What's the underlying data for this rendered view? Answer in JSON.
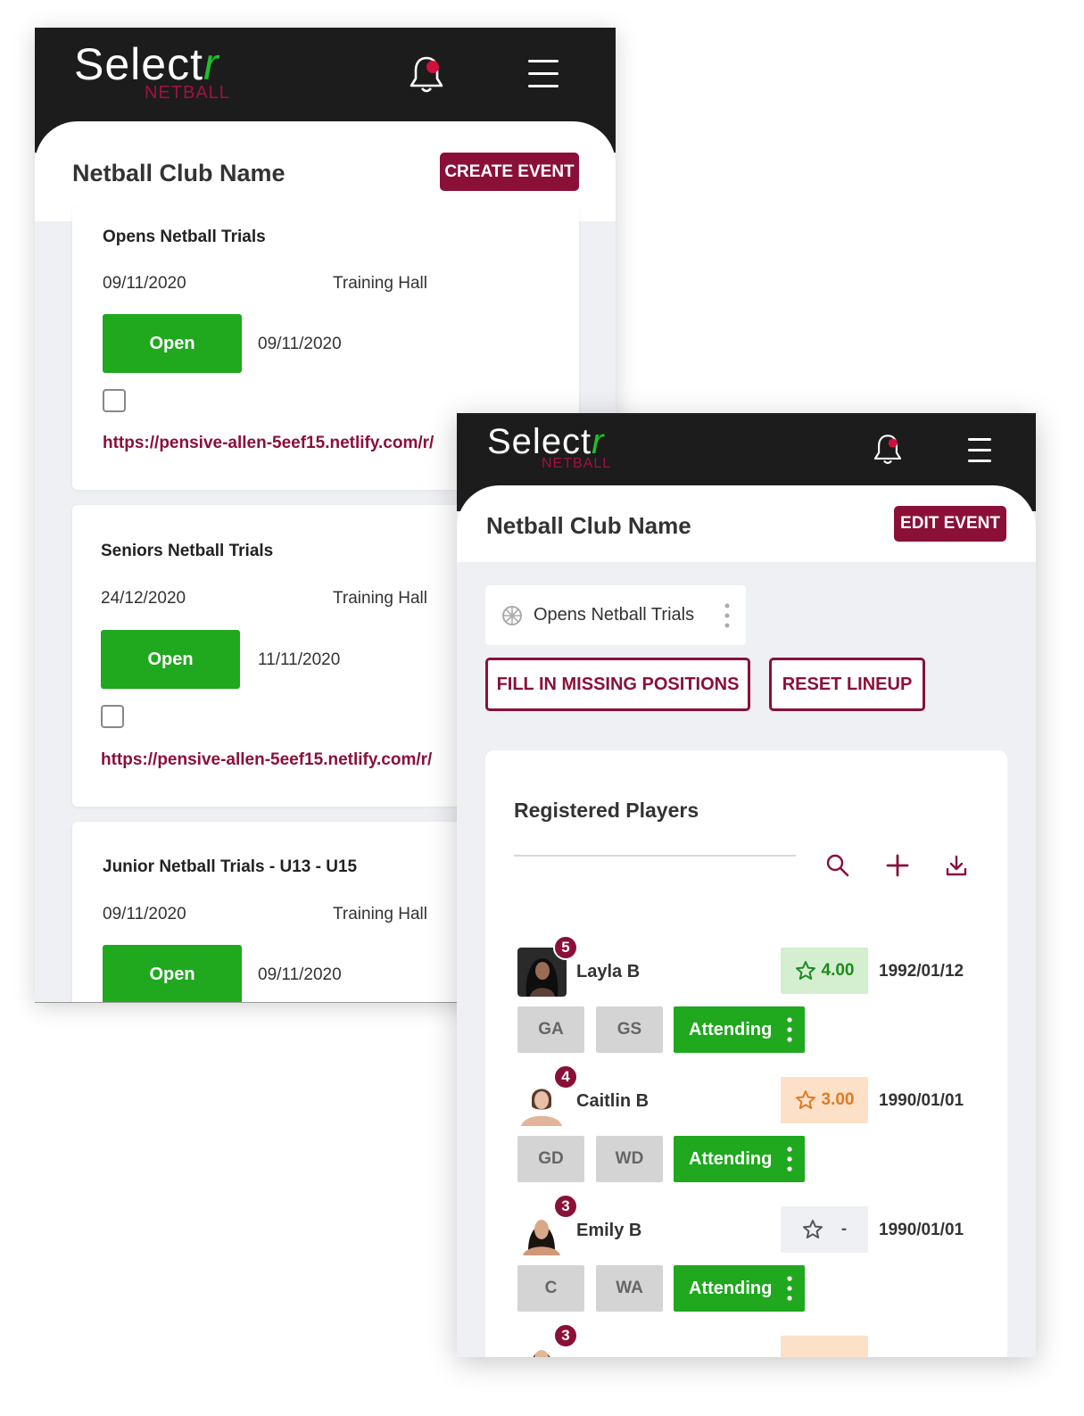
{
  "brand": {
    "word": "Select",
    "tick": "r",
    "sub": "NETBALL"
  },
  "screen1": {
    "club_name": "Netball Club Name",
    "create_label": "CREATE EVENT",
    "events": [
      {
        "title": "Opens Netball Trials",
        "date": "09/11/2020",
        "location": "Training Hall",
        "status": "Open",
        "status_date": "09/11/2020",
        "link": "https://pensive-allen-5eef15.netlify.com/r/"
      },
      {
        "title": "Seniors Netball Trials",
        "date": "24/12/2020",
        "location": "Training Hall",
        "status": "Open",
        "status_date": "11/11/2020",
        "link": "https://pensive-allen-5eef15.netlify.com/r/"
      },
      {
        "title": "Junior Netball Trials - U13 - U15",
        "date": "09/11/2020",
        "location": "Training Hall",
        "status": "Open",
        "status_date": "09/11/2020"
      }
    ]
  },
  "screen2": {
    "club_name": "Netball Club Name",
    "edit_label": "EDIT EVENT",
    "trial_select": "Opens Netball Trials",
    "fill_label": "FILL IN MISSING POSITIONS",
    "reset_label": "RESET LINEUP",
    "players_title": "Registered Players",
    "players": [
      {
        "rank": "5",
        "name": "Layla B",
        "rating": "4.00",
        "dob": "1992/01/12",
        "pos1": "GA",
        "pos2": "GS",
        "status": "Attending"
      },
      {
        "rank": "4",
        "name": "Caitlin B",
        "rating": "3.00",
        "dob": "1990/01/01",
        "pos1": "GD",
        "pos2": "WD",
        "status": "Attending"
      },
      {
        "rank": "3",
        "name": "Emily B",
        "rating": "-",
        "dob": "1990/01/01",
        "pos1": "C",
        "pos2": "WA",
        "status": "Attending"
      },
      {
        "rank": "3"
      }
    ]
  },
  "colors": {
    "maroon": "#8a1038",
    "green": "#20a81f",
    "topbar": "#1c1c1c",
    "rating_green_bg": "#d4efcf",
    "rating_orange_bg": "#fde0c8"
  },
  "icons": [
    "bell-icon",
    "menu-icon",
    "netball-icon",
    "more-vertical-icon",
    "search-icon",
    "plus-icon",
    "download-icon",
    "star-icon"
  ]
}
